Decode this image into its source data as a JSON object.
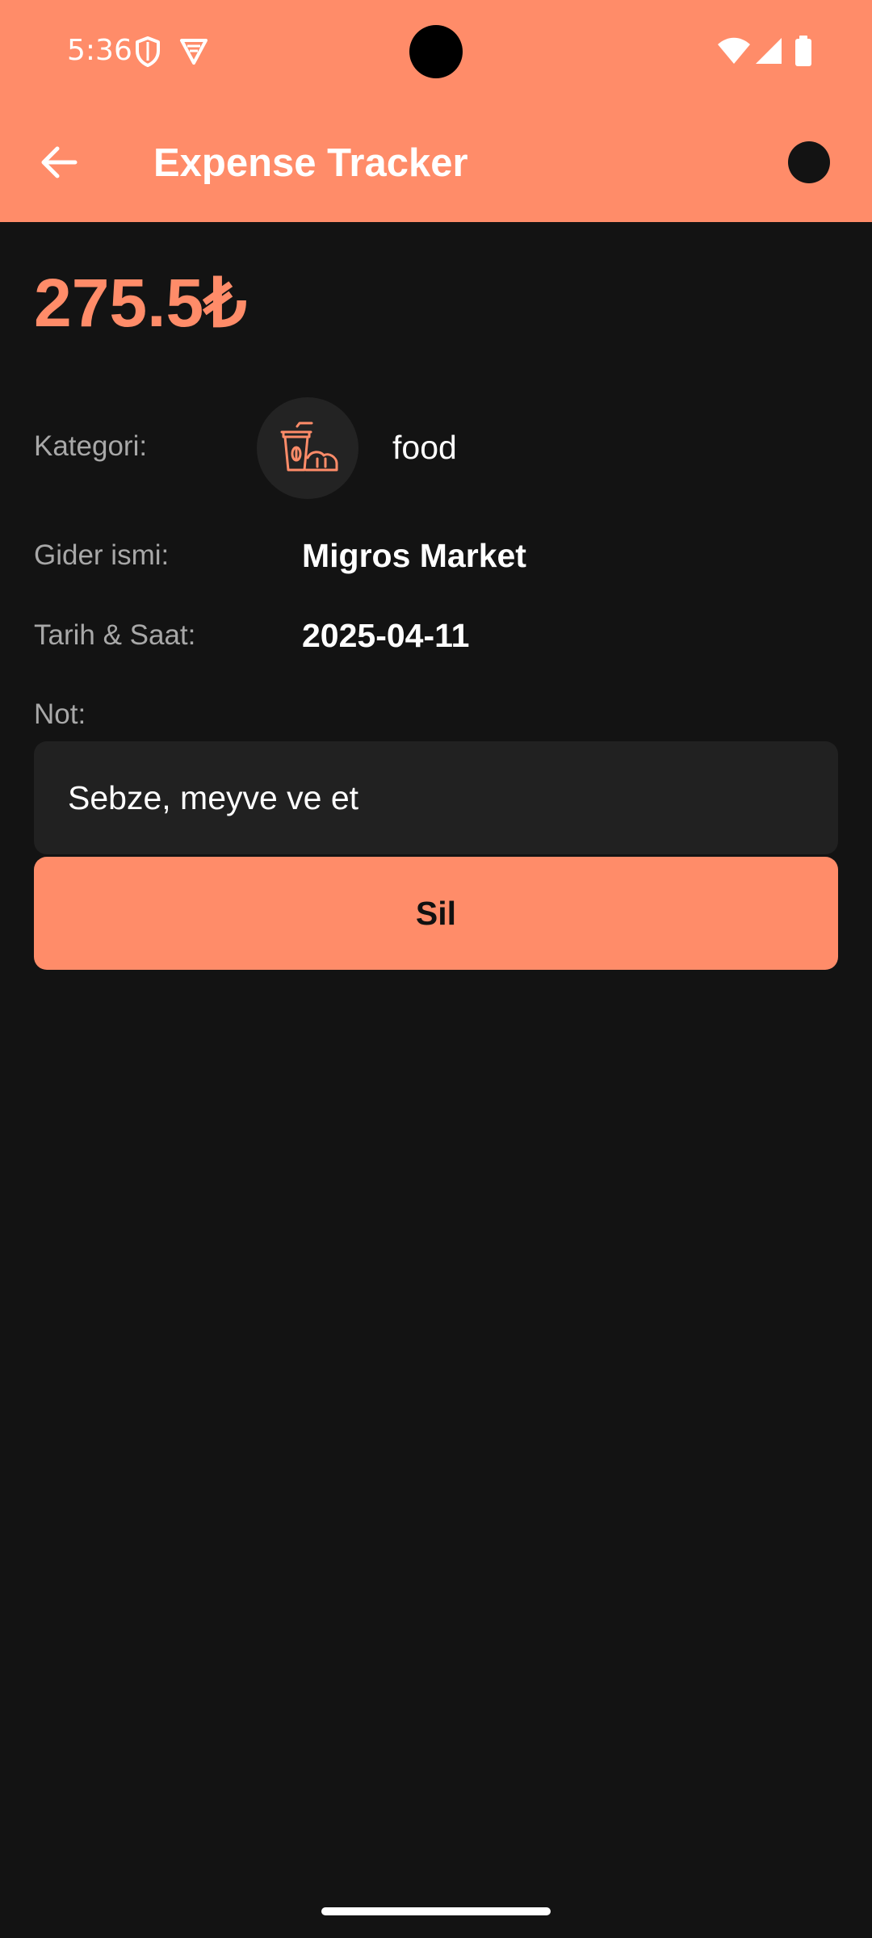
{
  "status_bar": {
    "time": "5:36",
    "icons_left": [
      "shield-icon",
      "vpn-icon"
    ],
    "icons_right": [
      "wifi-icon",
      "cell-signal-icon",
      "battery-icon"
    ]
  },
  "toolbar": {
    "back_icon": "arrow-left-icon",
    "title": "Expense Tracker"
  },
  "expense": {
    "amount": "275.5₺",
    "category_label": "Kategori:",
    "category_icon": "food-drink-icon",
    "category_value": "food",
    "name_label": "Gider ismi:",
    "name_value": "Migros Market",
    "date_label": "Tarih & Saat:",
    "date_value": "2025-04-11",
    "note_label": "Not:",
    "note_value": "Sebze, meyve ve et"
  },
  "actions": {
    "delete_label": "Sil"
  },
  "colors": {
    "accent": "#FF8C69",
    "background": "#131313",
    "surface": "#212121",
    "label_text": "#A8A8A8",
    "text": "#FFFFFF"
  }
}
